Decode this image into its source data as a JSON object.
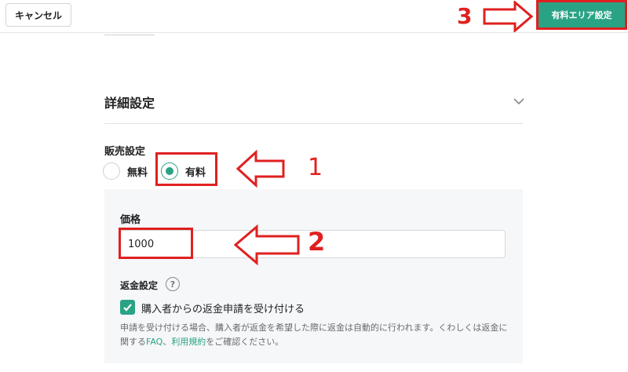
{
  "header": {
    "cancel_label": "キャンセル",
    "save_label": "有料エリア設定"
  },
  "details": {
    "title": "詳細設定"
  },
  "sales": {
    "label": "販売設定",
    "options": [
      {
        "label": "無料",
        "selected": false
      },
      {
        "label": "有料",
        "selected": true
      }
    ]
  },
  "price": {
    "label": "価格",
    "value": "1000"
  },
  "refund": {
    "label": "返金設定",
    "help_icon": "?",
    "checkbox_label": "購入者からの返金申請を受け付ける",
    "checked": true,
    "note_line1": "申請を受け付ける場合、購入者が返金を希望した際に返金は自動的に行われます。くわしくは返金に",
    "note_prefix": "関する",
    "note_link1": "FAQ",
    "note_sep": "、",
    "note_link2": "利用規約",
    "note_suffix": "をご確認ください。"
  },
  "annotations": {
    "step1": "1",
    "step2": "2",
    "step3": "3"
  },
  "colors": {
    "accent": "#2aa385",
    "annotation": "#e02020"
  }
}
